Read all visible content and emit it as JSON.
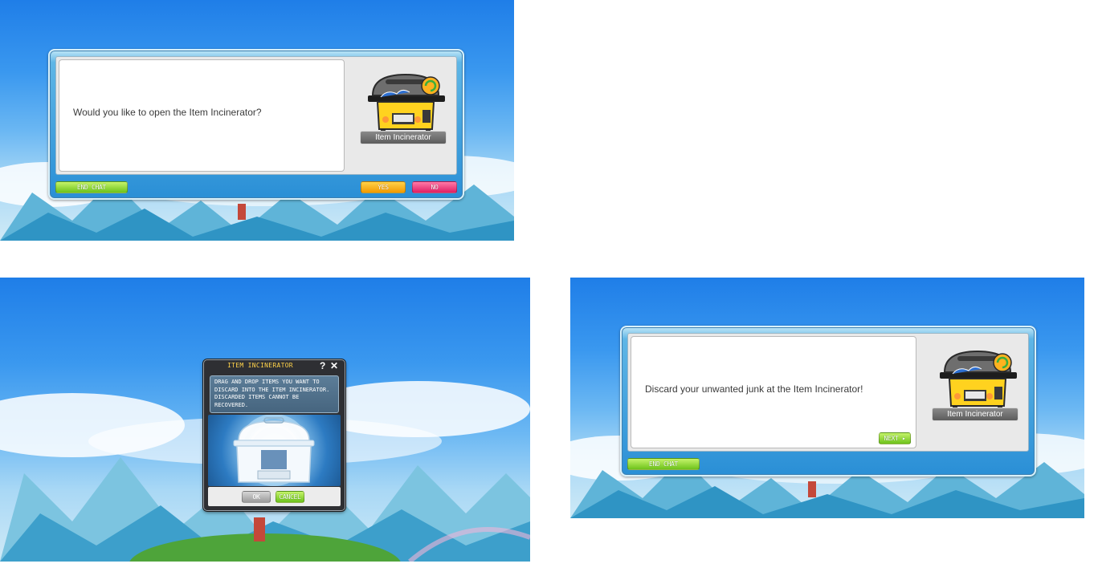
{
  "panel_top": {
    "dialog_text": "Would you like to open the Item Incinerator?",
    "npc_name": "Item Incinerator",
    "end_chat_label": "END CHAT",
    "yes_label": "YES",
    "no_label": "NO"
  },
  "panel_bottom_left": {
    "window_title": "ITEM INCINERATOR",
    "help_glyph": "?",
    "close_glyph": "✕",
    "description": "DRAG AND DROP ITEMS YOU WANT TO DISCARD INTO THE ITEM INCINERATOR. DISCARDED ITEMS CANNOT BE RECOVERED.",
    "ok_label": "OK",
    "cancel_label": "CANCEL"
  },
  "panel_bottom_right": {
    "dialog_text": "Discard your unwanted junk at the Item Incinerator!",
    "npc_name": "Item Incinerator",
    "next_label": "NEXT ▸",
    "end_chat_label": "END CHAT"
  }
}
